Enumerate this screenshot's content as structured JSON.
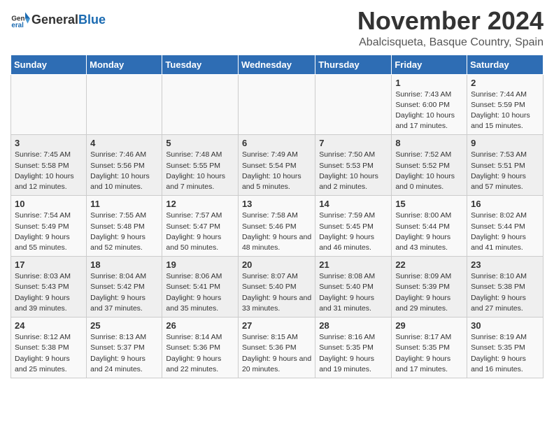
{
  "header": {
    "logo_general": "General",
    "logo_blue": "Blue",
    "month_title": "November 2024",
    "location": "Abalcisqueta, Basque Country, Spain"
  },
  "days_of_week": [
    "Sunday",
    "Monday",
    "Tuesday",
    "Wednesday",
    "Thursday",
    "Friday",
    "Saturday"
  ],
  "weeks": [
    [
      {
        "day": "",
        "info": ""
      },
      {
        "day": "",
        "info": ""
      },
      {
        "day": "",
        "info": ""
      },
      {
        "day": "",
        "info": ""
      },
      {
        "day": "",
        "info": ""
      },
      {
        "day": "1",
        "info": "Sunrise: 7:43 AM\nSunset: 6:00 PM\nDaylight: 10 hours and 17 minutes."
      },
      {
        "day": "2",
        "info": "Sunrise: 7:44 AM\nSunset: 5:59 PM\nDaylight: 10 hours and 15 minutes."
      }
    ],
    [
      {
        "day": "3",
        "info": "Sunrise: 7:45 AM\nSunset: 5:58 PM\nDaylight: 10 hours and 12 minutes."
      },
      {
        "day": "4",
        "info": "Sunrise: 7:46 AM\nSunset: 5:56 PM\nDaylight: 10 hours and 10 minutes."
      },
      {
        "day": "5",
        "info": "Sunrise: 7:48 AM\nSunset: 5:55 PM\nDaylight: 10 hours and 7 minutes."
      },
      {
        "day": "6",
        "info": "Sunrise: 7:49 AM\nSunset: 5:54 PM\nDaylight: 10 hours and 5 minutes."
      },
      {
        "day": "7",
        "info": "Sunrise: 7:50 AM\nSunset: 5:53 PM\nDaylight: 10 hours and 2 minutes."
      },
      {
        "day": "8",
        "info": "Sunrise: 7:52 AM\nSunset: 5:52 PM\nDaylight: 10 hours and 0 minutes."
      },
      {
        "day": "9",
        "info": "Sunrise: 7:53 AM\nSunset: 5:51 PM\nDaylight: 9 hours and 57 minutes."
      }
    ],
    [
      {
        "day": "10",
        "info": "Sunrise: 7:54 AM\nSunset: 5:49 PM\nDaylight: 9 hours and 55 minutes."
      },
      {
        "day": "11",
        "info": "Sunrise: 7:55 AM\nSunset: 5:48 PM\nDaylight: 9 hours and 52 minutes."
      },
      {
        "day": "12",
        "info": "Sunrise: 7:57 AM\nSunset: 5:47 PM\nDaylight: 9 hours and 50 minutes."
      },
      {
        "day": "13",
        "info": "Sunrise: 7:58 AM\nSunset: 5:46 PM\nDaylight: 9 hours and 48 minutes."
      },
      {
        "day": "14",
        "info": "Sunrise: 7:59 AM\nSunset: 5:45 PM\nDaylight: 9 hours and 46 minutes."
      },
      {
        "day": "15",
        "info": "Sunrise: 8:00 AM\nSunset: 5:44 PM\nDaylight: 9 hours and 43 minutes."
      },
      {
        "day": "16",
        "info": "Sunrise: 8:02 AM\nSunset: 5:44 PM\nDaylight: 9 hours and 41 minutes."
      }
    ],
    [
      {
        "day": "17",
        "info": "Sunrise: 8:03 AM\nSunset: 5:43 PM\nDaylight: 9 hours and 39 minutes."
      },
      {
        "day": "18",
        "info": "Sunrise: 8:04 AM\nSunset: 5:42 PM\nDaylight: 9 hours and 37 minutes."
      },
      {
        "day": "19",
        "info": "Sunrise: 8:06 AM\nSunset: 5:41 PM\nDaylight: 9 hours and 35 minutes."
      },
      {
        "day": "20",
        "info": "Sunrise: 8:07 AM\nSunset: 5:40 PM\nDaylight: 9 hours and 33 minutes."
      },
      {
        "day": "21",
        "info": "Sunrise: 8:08 AM\nSunset: 5:40 PM\nDaylight: 9 hours and 31 minutes."
      },
      {
        "day": "22",
        "info": "Sunrise: 8:09 AM\nSunset: 5:39 PM\nDaylight: 9 hours and 29 minutes."
      },
      {
        "day": "23",
        "info": "Sunrise: 8:10 AM\nSunset: 5:38 PM\nDaylight: 9 hours and 27 minutes."
      }
    ],
    [
      {
        "day": "24",
        "info": "Sunrise: 8:12 AM\nSunset: 5:38 PM\nDaylight: 9 hours and 25 minutes."
      },
      {
        "day": "25",
        "info": "Sunrise: 8:13 AM\nSunset: 5:37 PM\nDaylight: 9 hours and 24 minutes."
      },
      {
        "day": "26",
        "info": "Sunrise: 8:14 AM\nSunset: 5:36 PM\nDaylight: 9 hours and 22 minutes."
      },
      {
        "day": "27",
        "info": "Sunrise: 8:15 AM\nSunset: 5:36 PM\nDaylight: 9 hours and 20 minutes."
      },
      {
        "day": "28",
        "info": "Sunrise: 8:16 AM\nSunset: 5:35 PM\nDaylight: 9 hours and 19 minutes."
      },
      {
        "day": "29",
        "info": "Sunrise: 8:17 AM\nSunset: 5:35 PM\nDaylight: 9 hours and 17 minutes."
      },
      {
        "day": "30",
        "info": "Sunrise: 8:19 AM\nSunset: 5:35 PM\nDaylight: 9 hours and 16 minutes."
      }
    ]
  ]
}
